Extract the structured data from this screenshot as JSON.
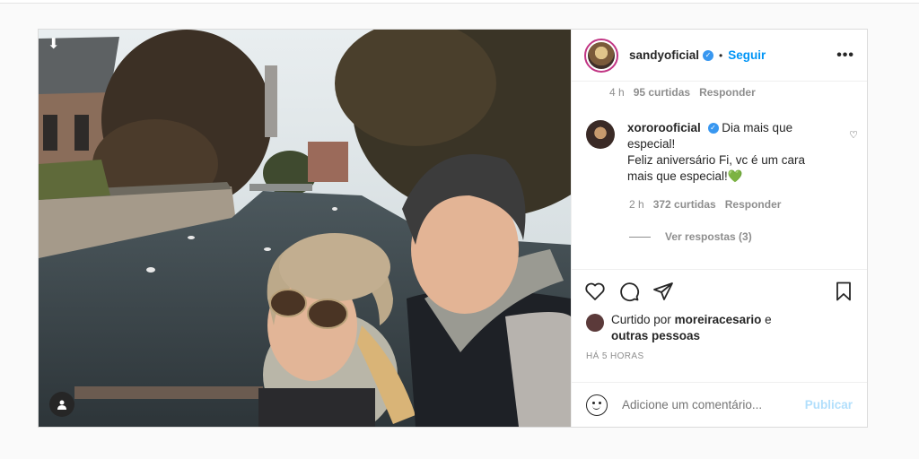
{
  "post": {
    "author": "sandyoficial",
    "follow_label": "Seguir",
    "dot": "•",
    "more_label": "•••"
  },
  "previous_comment": {
    "time": "4 h",
    "likes": "95 curtidas",
    "reply": "Responder"
  },
  "comment": {
    "username": "xororooficial",
    "text_line1": "Dia mais que especial!",
    "text_line2": "Feliz aniversário Fi, vc é um cara mais que especial!💚",
    "time": "2 h",
    "likes": "372 curtidas",
    "reply": "Responder",
    "view_replies": "Ver respostas (3)"
  },
  "likes": {
    "prefix": "Curtido por",
    "user": "moreiracesario",
    "connector": "e",
    "others": "outras pessoas"
  },
  "timestamp": "HÁ 5 HORAS",
  "add_comment": {
    "placeholder": "Adicione um comentário...",
    "publish_label": "Publicar"
  },
  "colors": {
    "accent": "#0095f6",
    "publish_disabled": "#b2dffc",
    "verified": "#3897f0"
  },
  "icons": [
    "download-arrow-icon",
    "user-tag-icon",
    "verified-icon",
    "more-icon",
    "heart-icon",
    "like-icon",
    "comment-icon",
    "share-icon",
    "save-icon",
    "emoji-icon"
  ]
}
